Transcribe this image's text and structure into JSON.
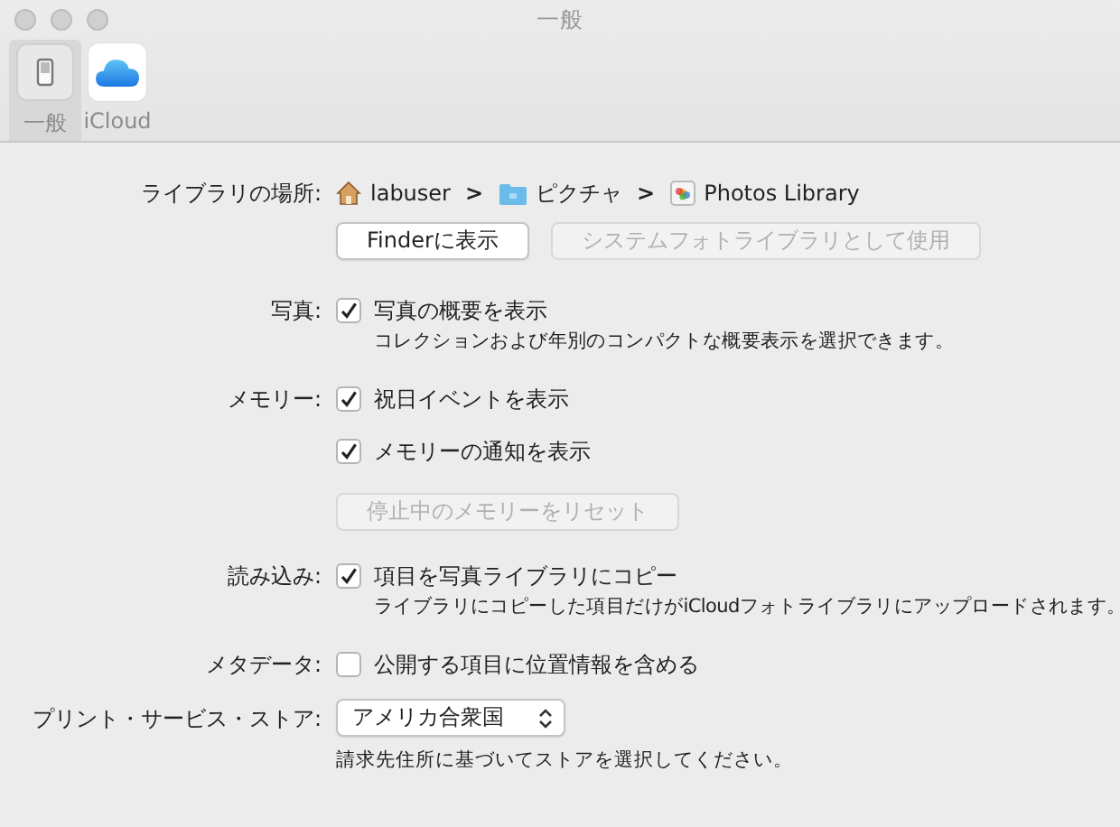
{
  "window": {
    "title": "一般"
  },
  "toolbar": [
    {
      "label": "一般",
      "kind": "general",
      "selected": true
    },
    {
      "label": "iCloud",
      "kind": "icloud",
      "selected": false
    }
  ],
  "sections": [
    {
      "label": "ライブラリの場所:",
      "items": [
        {
          "kind": "path",
          "separator": ">",
          "segments": [
            {
              "kind": "home",
              "text": "labuser"
            },
            {
              "kind": "folder",
              "text": "ピクチャ"
            },
            {
              "kind": "library",
              "text": "Photos Library"
            }
          ]
        },
        {
          "kind": "buttons",
          "buttons": [
            {
              "label": "Finderに表示",
              "disabled": false
            },
            {
              "label": "システムフォトライブラリとして使用",
              "disabled": true
            }
          ]
        }
      ]
    },
    {
      "label": "写真:",
      "items": [
        {
          "kind": "checkbox",
          "label": "写真の概要を表示",
          "checked": true,
          "note": "コレクションおよび年別のコンパクトな概要表示を選択できます。"
        }
      ]
    },
    {
      "label": "メモリー:",
      "items": [
        {
          "kind": "checkbox",
          "label": "祝日イベントを表示",
          "checked": true
        },
        {
          "kind": "checkbox",
          "label": "メモリーの通知を表示",
          "checked": true
        },
        {
          "kind": "buttons",
          "buttons": [
            {
              "label": "停止中のメモリーをリセット",
              "disabled": true
            }
          ]
        }
      ]
    },
    {
      "label": "読み込み:",
      "items": [
        {
          "kind": "checkbox",
          "label": "項目を写真ライブラリにコピー",
          "checked": true,
          "note": "ライブラリにコピーした項目だけがiCloudフォトライブラリにアップロードされます。"
        }
      ]
    },
    {
      "label": "メタデータ:",
      "items": [
        {
          "kind": "checkbox",
          "label": "公開する項目に位置情報を含める",
          "checked": false
        }
      ]
    },
    {
      "label": "プリント・サービス・ストア:",
      "items": [
        {
          "kind": "popup",
          "value": "アメリカ合衆国",
          "note": "請求先住所に基づいてストアを選択してください。"
        }
      ]
    }
  ]
}
